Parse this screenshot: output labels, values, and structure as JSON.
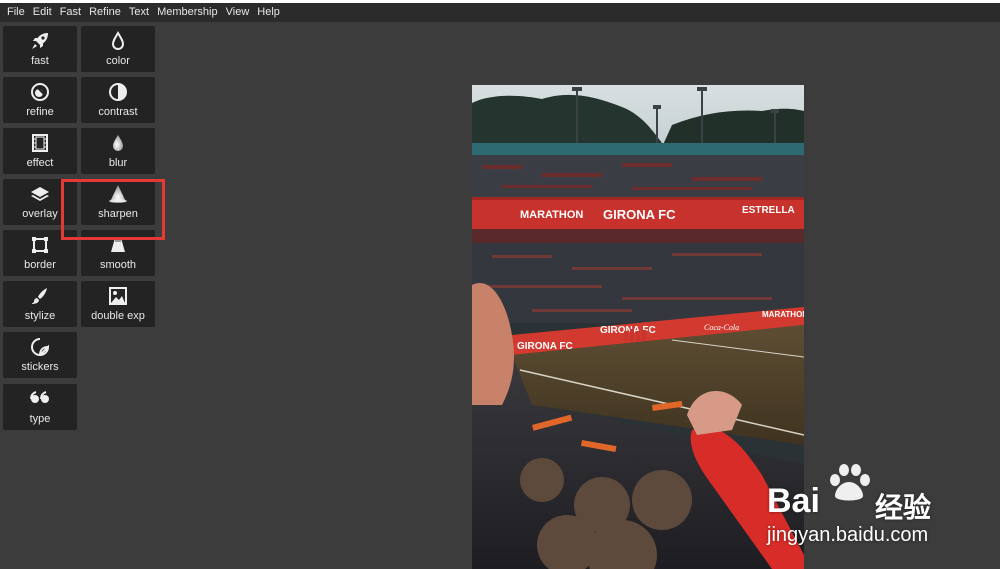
{
  "menu": [
    "File",
    "Edit",
    "Fast",
    "Refine",
    "Text",
    "Membership",
    "View",
    "Help"
  ],
  "tools": {
    "fast": {
      "label": "fast",
      "icon": "rocket-icon"
    },
    "color": {
      "label": "color",
      "icon": "drop-icon"
    },
    "refine": {
      "label": "refine",
      "icon": "refine-icon"
    },
    "contrast": {
      "label": "contrast",
      "icon": "contrast-icon"
    },
    "effect": {
      "label": "effect",
      "icon": "film-icon"
    },
    "blur": {
      "label": "blur",
      "icon": "blur-drop-icon"
    },
    "overlay": {
      "label": "overlay",
      "icon": "layers-icon"
    },
    "sharpen": {
      "label": "sharpen",
      "icon": "prism-icon"
    },
    "border": {
      "label": "border",
      "icon": "frame-icon"
    },
    "smooth": {
      "label": "smooth",
      "icon": "smooth-icon"
    },
    "stylize": {
      "label": "stylize",
      "icon": "brush-icon"
    },
    "double_exp": {
      "label": "double exp",
      "icon": "image-icon"
    },
    "stickers": {
      "label": "stickers",
      "icon": "sticker-icon"
    },
    "type": {
      "label": "type",
      "icon": "quote-icon"
    }
  },
  "photo": {
    "banner_upper": [
      "MARATHON",
      "GIRONA FC",
      "ESTRELLA"
    ],
    "banner_lower": [
      "GIRONA FC",
      "Coca-Cola",
      "MARATHON",
      "Coca-Cola"
    ]
  },
  "watermark": {
    "brand": "Bai",
    "brand_cn": "经验",
    "url": "jingyan.baidu.com"
  },
  "colors": {
    "background": "#3c3c3c",
    "menubar": "#2b2b2b",
    "tool_button": "#232323",
    "highlight": "#e53935"
  }
}
